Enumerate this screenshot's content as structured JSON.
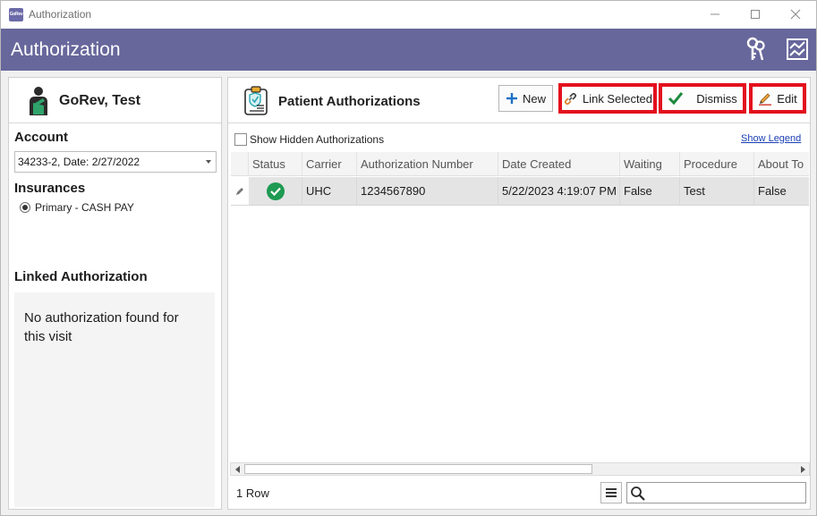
{
  "window": {
    "title": "Authorization",
    "app_icon_text": "GoRev"
  },
  "header": {
    "title": "Authorization"
  },
  "patient": {
    "name": "GoRev,  Test"
  },
  "account": {
    "label": "Account",
    "selected": "34233-2, Date: 2/27/2022"
  },
  "insurances": {
    "label": "Insurances",
    "items": [
      {
        "label": "Primary - CASH PAY",
        "selected": true
      }
    ]
  },
  "linked": {
    "label": "Linked Authorization",
    "message": "No authorization found for this visit"
  },
  "authorizations": {
    "title": "Patient Authorizations",
    "buttons": {
      "new": "New",
      "link_selected": "Link Selected",
      "dismiss": "Dismiss",
      "edit": "Edit"
    },
    "show_hidden_label": "Show Hidden Authorizations",
    "show_legend": "Show Legend",
    "columns": [
      "Status",
      "Carrier",
      "Authorization Number",
      "Date Created",
      "Waiting",
      "Procedure",
      "About To"
    ],
    "rows": [
      {
        "status": "approved",
        "carrier": "UHC",
        "authorization_number": "1234567890",
        "date_created": "5/22/2023 4:19:07 PM",
        "waiting": "False",
        "procedure": "Test",
        "about_to": "False"
      }
    ],
    "row_count": "1 Row",
    "search": {
      "value": "",
      "placeholder": ""
    }
  },
  "colors": {
    "header_bg": "#67679c",
    "highlight_border": "#e3101d",
    "status_ok": "#1e9a52",
    "link": "#1a3fb4"
  },
  "icons": {
    "header_right": [
      "keys-icon",
      "chart-icon"
    ],
    "status_ok": "check-circle-icon",
    "row_edit": "pencil-icon"
  }
}
